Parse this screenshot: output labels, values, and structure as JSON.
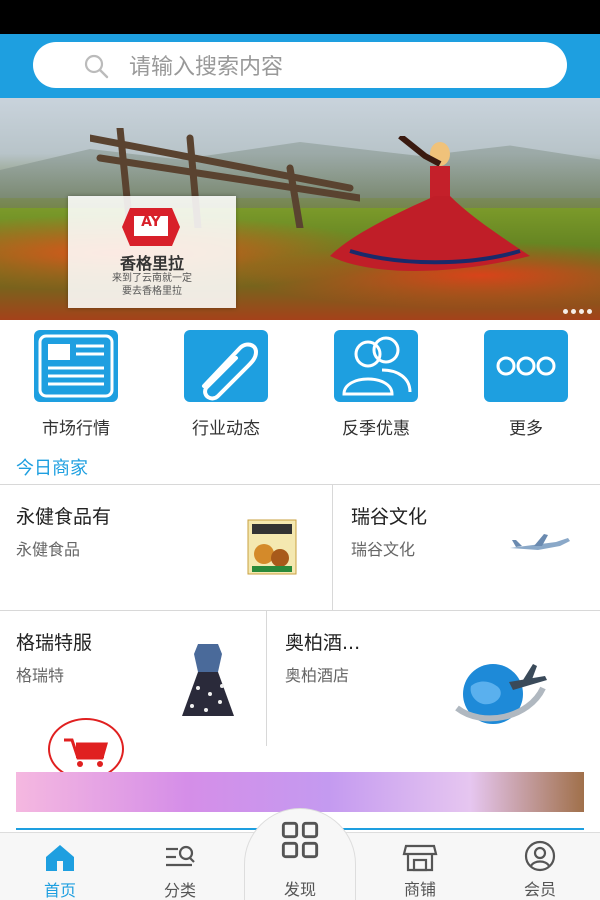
{
  "search": {
    "placeholder": "请输入搜索内容"
  },
  "banner": {
    "logo_text": "AY",
    "title": "香格里拉",
    "subtitle": "来到了云南就一定\n要去香格里拉"
  },
  "quick_nav": [
    {
      "label": "市场行情",
      "icon": "newspaper-icon"
    },
    {
      "label": "行业动态",
      "icon": "paperclip-icon"
    },
    {
      "label": "反季优惠",
      "icon": "users-icon"
    },
    {
      "label": "更多",
      "icon": "more-dots-icon"
    }
  ],
  "section": {
    "title": "今日商家"
  },
  "merchants": [
    {
      "name": "永健食品有",
      "sub": "永健食品",
      "image": "snack-package-image"
    },
    {
      "name": "瑞谷文化",
      "sub": "瑞谷文化",
      "image": "airplane-image"
    },
    {
      "name": "格瑞特服",
      "sub": "格瑞特",
      "image": "dress-image"
    },
    {
      "name": "奥柏酒...",
      "sub": "奥柏酒店",
      "image": "globe-airplane-image"
    }
  ],
  "tabs": [
    {
      "label": "首页",
      "icon": "home-icon",
      "active": true
    },
    {
      "label": "分类",
      "icon": "category-search-icon",
      "active": false
    },
    {
      "label": "发现",
      "icon": "grid-icon",
      "active": false
    },
    {
      "label": "商铺",
      "icon": "store-icon",
      "active": false
    },
    {
      "label": "会员",
      "icon": "user-circle-icon",
      "active": false
    }
  ],
  "colors": {
    "primary": "#1e9fe0",
    "cart": "#e02020"
  }
}
